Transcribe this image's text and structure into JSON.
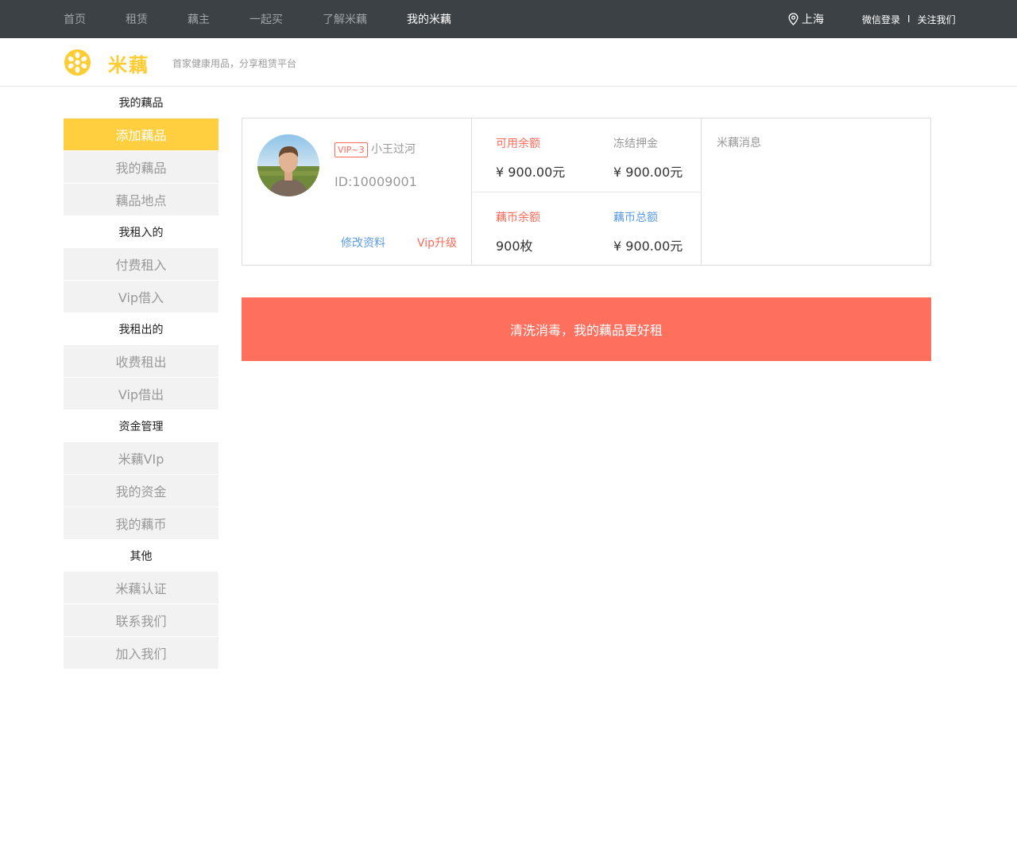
{
  "topnav": {
    "items": [
      "首页",
      "租赁",
      "藕主",
      "一起买",
      "了解米藕",
      "我的米藕"
    ],
    "active_index": 5
  },
  "location": {
    "city": "上海",
    "icon": "location-pin-icon"
  },
  "auth": {
    "wechat_login": "微信登录",
    "separator": "I",
    "follow_us": "关注我们"
  },
  "header": {
    "logo_text": "米藕",
    "slogan": "首家健康用品，分享租赁平台",
    "brand_color": "#ffcc33"
  },
  "sidebar": {
    "groups": [
      {
        "title": "我的藕品",
        "items": [
          "添加藕品",
          "我的藕品",
          "藕品地点"
        ]
      },
      {
        "title": "我租入的",
        "items": [
          "付费租入",
          "Vip借入"
        ]
      },
      {
        "title": "我租出的",
        "items": [
          "收费租出",
          "Vip借出"
        ]
      },
      {
        "title": "资金管理",
        "items": [
          "米藕VIp",
          "我的资金",
          "我的藕币"
        ]
      },
      {
        "title": "其他",
        "items": [
          "米藕认证",
          "联系我们",
          "加入我们"
        ]
      }
    ],
    "active_item": "添加藕品"
  },
  "profile": {
    "vip_badge": "VIP~3",
    "username": "小王过河",
    "user_id": "ID:10009001",
    "edit_link": "修改资料",
    "upgrade_link": "Vip升级"
  },
  "stats": {
    "available_label": "可用余额",
    "available_value": "¥ 900.00元",
    "frozen_label": "冻结押金",
    "frozen_value": "¥ 900.00元",
    "coin_balance_label": "藕币余额",
    "coin_balance_value": "900枚",
    "coin_total_label": "藕币总额",
    "coin_total_value": "¥ 900.00元"
  },
  "messages": {
    "title": "米藕消息"
  },
  "banner": {
    "text": "清洗消毒，我的藕品更好租",
    "color": "#ff6f5e"
  }
}
